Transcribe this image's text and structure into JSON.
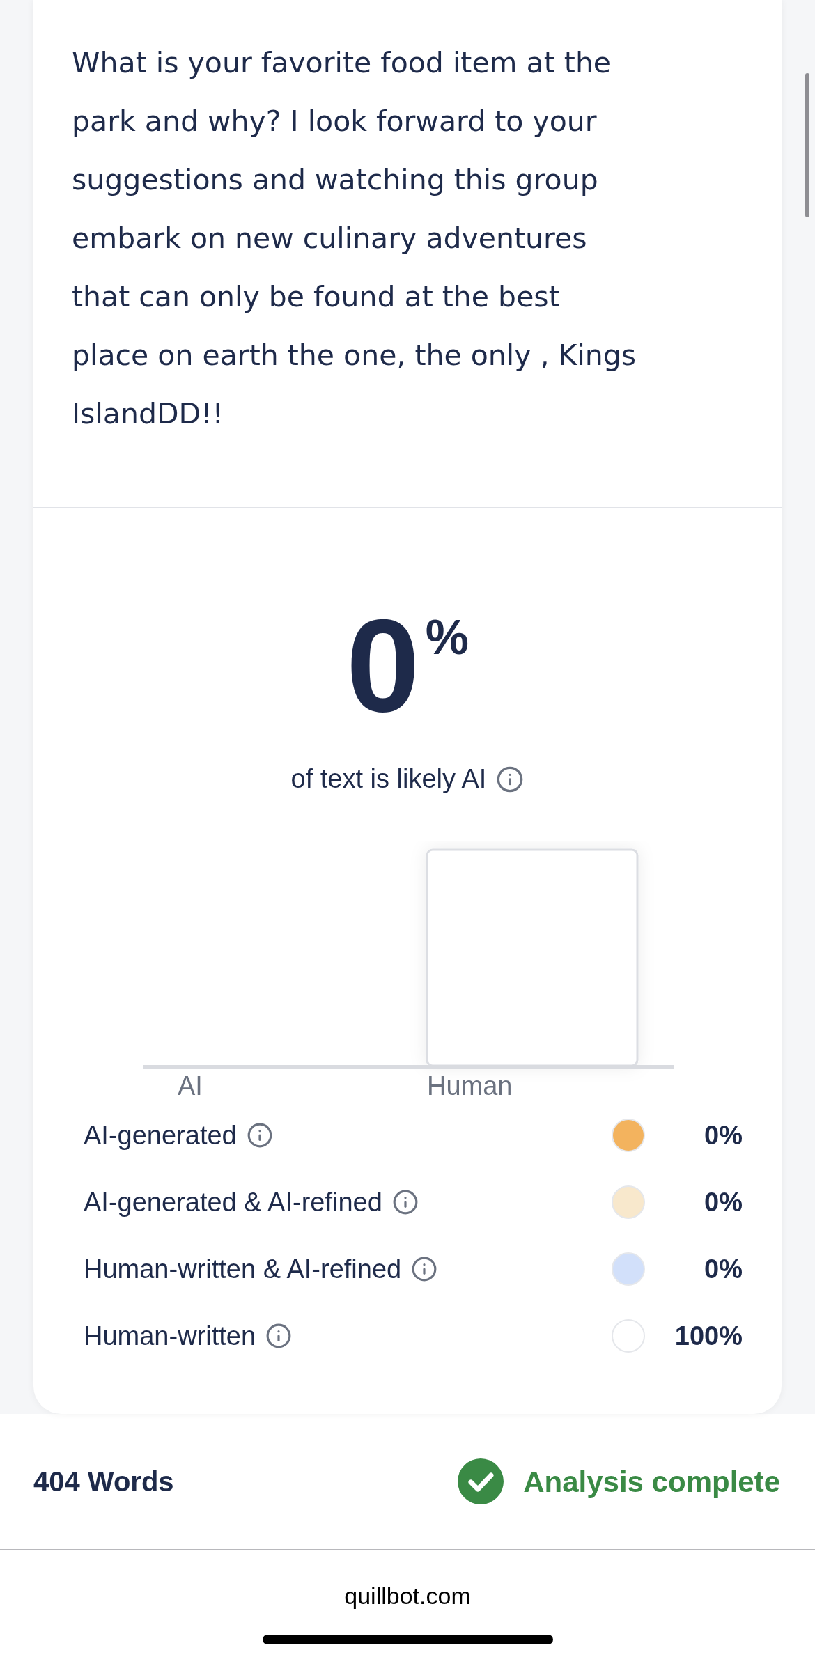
{
  "input_text": "What is your favorite food item at the park and why? I look forward to your suggestions and watching this group embark on new culinary adventures that can only be found at the best place on earth the one, the only , Kings IslandDD!!",
  "result": {
    "score": "0",
    "unit": "%",
    "caption": "of text is likely AI",
    "chart": {
      "categories": [
        "AI",
        "Human"
      ]
    },
    "legend": [
      {
        "label": "AI-generated",
        "color": "#f3b35e",
        "value": "0%"
      },
      {
        "label": "AI-generated & AI-refined",
        "color": "#f8e8cc",
        "value": "0%"
      },
      {
        "label": "Human-written & AI-refined",
        "color": "#d2e0fa",
        "value": "0%"
      },
      {
        "label": "Human-written",
        "color": "#ffffff",
        "value": "100%"
      }
    ]
  },
  "footer": {
    "word_count": "404 Words",
    "status": "Analysis complete",
    "complete": true
  },
  "browser": {
    "url": "quillbot.com"
  }
}
